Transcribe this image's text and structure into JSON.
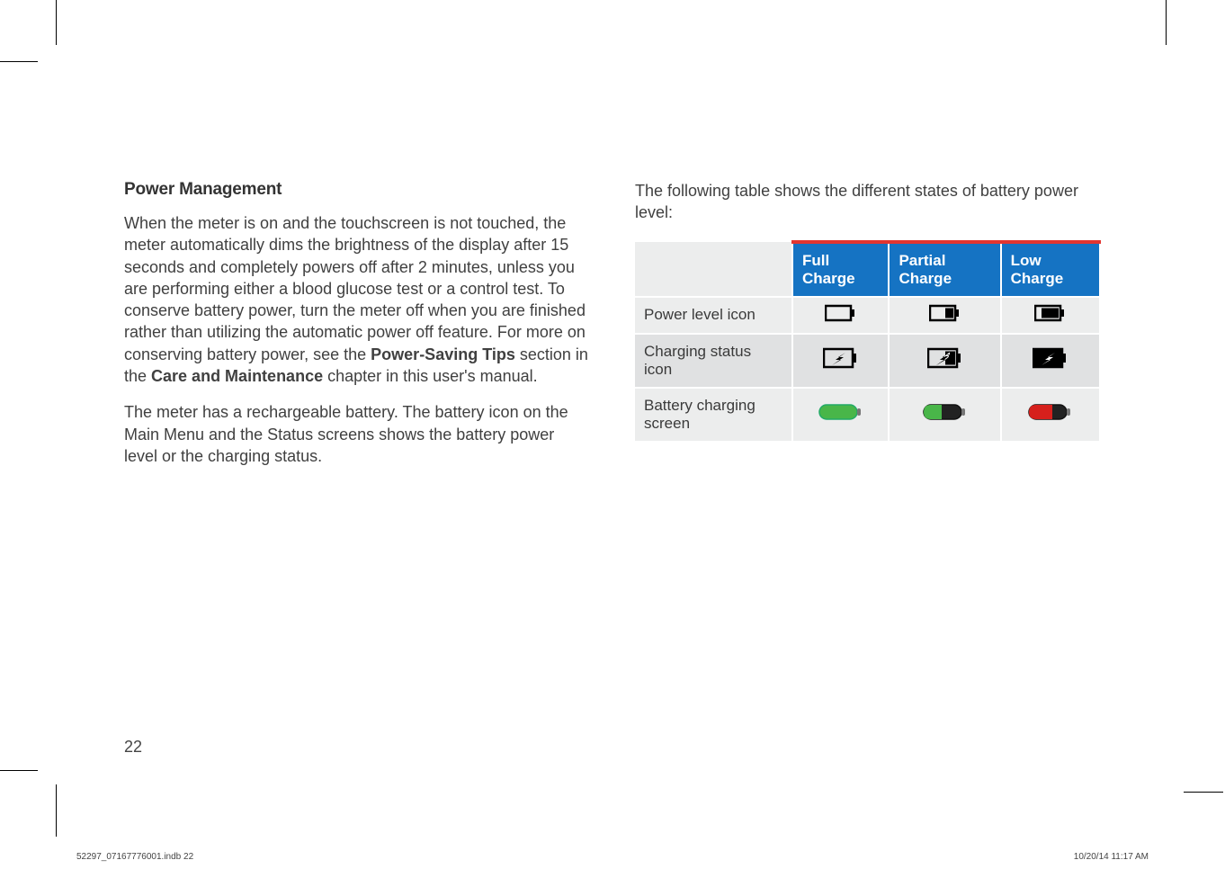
{
  "heading": "Power Management",
  "para1_parts": [
    "When the meter is on and the touchscreen is not touched, the meter automatically dims the brightness of the display after 15 seconds and completely powers off after 2 minutes, unless you are performing either a blood glucose test or a control test. To conserve battery power, turn the meter off when you are finished rather than utilizing the automatic power off feature. For more on conserving battery power, see the ",
    "Power-Saving Tips",
    " section in the ",
    "Care and Maintenance",
    " chapter in this user's manual."
  ],
  "para2": "The meter has a rechargeable battery. The battery icon on the Main Menu and the Status screens shows the battery power level or the charging status.",
  "right_intro": "The following table shows the different states of battery power level:",
  "table": {
    "headers": [
      "",
      "Full Charge",
      "Partial Charge",
      "Low Charge"
    ],
    "rows": [
      {
        "label": "Power level icon"
      },
      {
        "label": "Charging status icon"
      },
      {
        "label": "Battery charging screen"
      }
    ]
  },
  "page_number": "22",
  "footer_left": "52297_07167776001.indb   22",
  "footer_right": "10/20/14   11:17 AM"
}
